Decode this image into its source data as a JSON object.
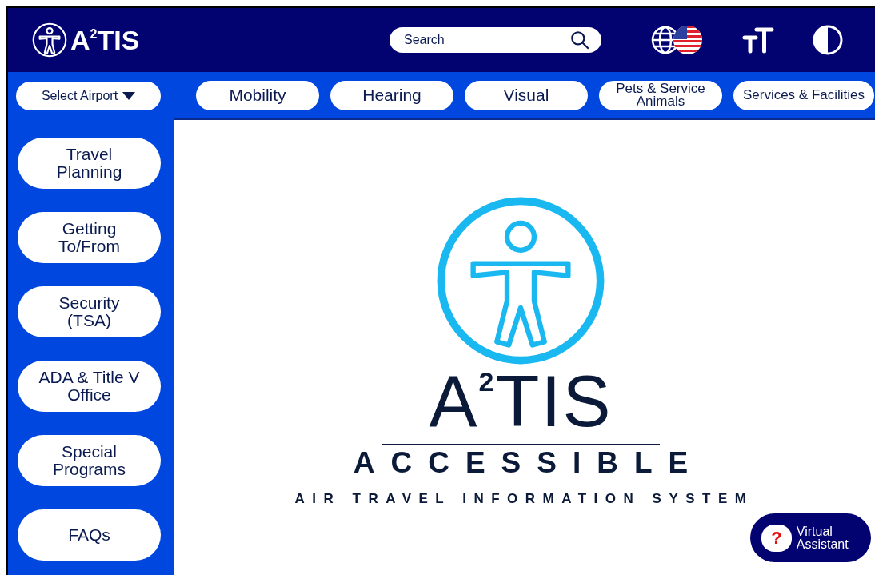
{
  "header": {
    "logo": "A$^{2}$TIS",
    "search": {
      "placeholder": "Search"
    }
  },
  "nav": {
    "select_airport": "Select Airport",
    "tabs": [
      {
        "label": "Mobility"
      },
      {
        "label": "Hearing"
      },
      {
        "label": "Visual"
      },
      {
        "label": "Pets & Service Animals"
      },
      {
        "label": "Services & Facilities"
      }
    ]
  },
  "sidebar": {
    "items": [
      {
        "label": "Travel Planning"
      },
      {
        "label": "Getting To/From"
      },
      {
        "label": "Security (TSA)"
      },
      {
        "label": "ADA & Title V Office"
      },
      {
        "label": "Special Programs"
      },
      {
        "label": "FAQs"
      }
    ]
  },
  "hero": {
    "title": "A$^{2}$TIS",
    "subtitle": "ACCESSIBLE",
    "tagline": "AIR TRAVEL INFORMATION SYSTEM"
  },
  "assistant": {
    "mark": "?",
    "label": "Virtual Assistant"
  }
}
